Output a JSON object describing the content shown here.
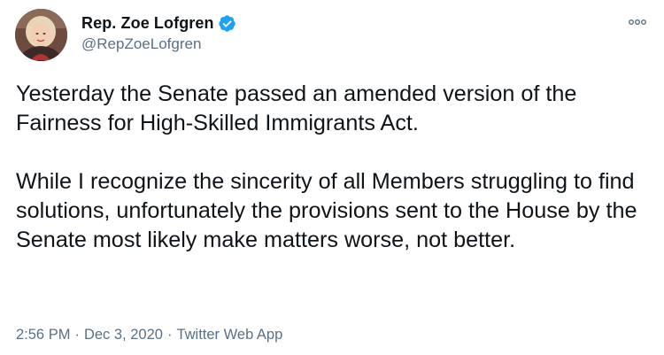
{
  "author": {
    "display_name": "Rep. Zoe Lofgren",
    "handle": "@RepZoeLofgren",
    "verified": true,
    "avatar_icon": "profile-photo"
  },
  "tweet": {
    "paragraphs": [
      "Yesterday the Senate passed an amended version of the Fairness for High-Skilled Immigrants Act.",
      "While I recognize the sincerity of all Members struggling to find solutions, unfortunately the provisions sent to the House by the Senate most likely make matters worse, not better."
    ]
  },
  "meta": {
    "time": "2:56 PM",
    "separator": "·",
    "date": "Dec 3, 2020",
    "source": "Twitter Web App"
  },
  "icons": {
    "verified": "verified-badge-icon",
    "more": "more-options-icon"
  },
  "colors": {
    "text": "#0f1419",
    "secondary": "#5b7083",
    "verified_blue": "#1da1f2"
  }
}
